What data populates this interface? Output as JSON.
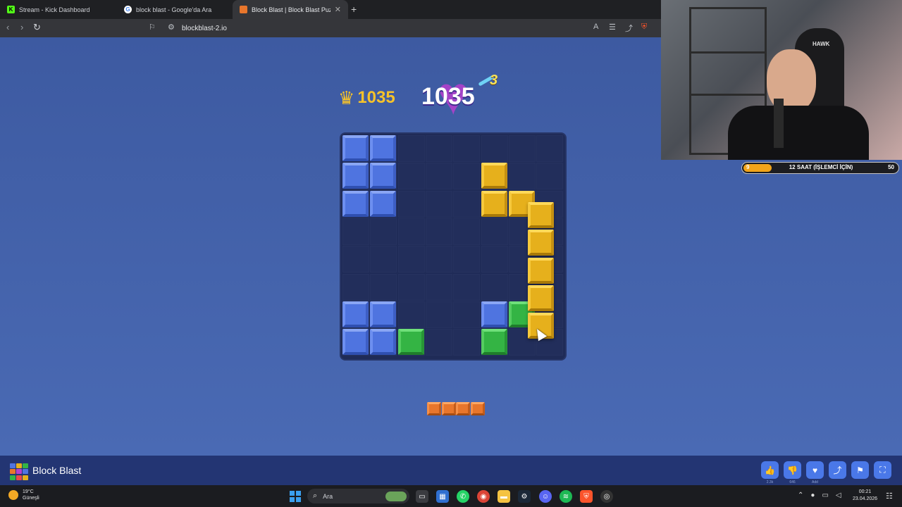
{
  "browser": {
    "tabs": [
      {
        "title": "Stream - Kick Dashboard",
        "icon": "kick-icon",
        "color": "#53fc18",
        "active": false
      },
      {
        "title": "block blast - Google'da Ara",
        "icon": "google-icon",
        "color": "#ffffff",
        "active": false
      },
      {
        "title": "Block Blast | Block Blast Puzzle G",
        "icon": "block-blast-icon",
        "color": "#e8762c",
        "active": true
      }
    ],
    "url": "blockblast-2.io"
  },
  "game": {
    "best_score": "1035",
    "current_score": "1035",
    "combo": "3",
    "board": {
      "rows": 8,
      "cols": 8,
      "blocks": [
        {
          "r": 0,
          "c": 0,
          "color": "blue"
        },
        {
          "r": 0,
          "c": 1,
          "color": "blue"
        },
        {
          "r": 1,
          "c": 0,
          "color": "blue"
        },
        {
          "r": 1,
          "c": 1,
          "color": "blue"
        },
        {
          "r": 2,
          "c": 0,
          "color": "blue"
        },
        {
          "r": 2,
          "c": 1,
          "color": "blue"
        },
        {
          "r": 1,
          "c": 5,
          "color": "yellow"
        },
        {
          "r": 2,
          "c": 5,
          "color": "yellow"
        },
        {
          "r": 2,
          "c": 6,
          "color": "yellow"
        },
        {
          "r": 6,
          "c": 0,
          "color": "blue"
        },
        {
          "r": 6,
          "c": 1,
          "color": "blue"
        },
        {
          "r": 7,
          "c": 0,
          "color": "blue"
        },
        {
          "r": 7,
          "c": 1,
          "color": "blue"
        },
        {
          "r": 7,
          "c": 2,
          "color": "green"
        },
        {
          "r": 6,
          "c": 5,
          "color": "blue"
        },
        {
          "r": 6,
          "c": 6,
          "color": "green"
        },
        {
          "r": 7,
          "c": 5,
          "color": "green"
        }
      ],
      "dragging_piece": {
        "color": "yellow",
        "cells": 5,
        "orientation": "vertical"
      }
    },
    "next_pieces": [
      {
        "color": "orange",
        "cells": 4,
        "orientation": "horizontal"
      }
    ],
    "title": "Block Blast",
    "actions": [
      {
        "name": "like-button",
        "icon": "thumbs-up-icon",
        "glyph": "👍",
        "count": "2.3k"
      },
      {
        "name": "dislike-button",
        "icon": "thumbs-down-icon",
        "glyph": "👎",
        "count": "646"
      },
      {
        "name": "favorite-button",
        "icon": "heart-icon",
        "glyph": "♥",
        "count": "Add"
      },
      {
        "name": "share-button",
        "icon": "share-icon",
        "glyph": "⤴",
        "count": ""
      },
      {
        "name": "report-button",
        "icon": "flag-icon",
        "glyph": "⚑",
        "count": ""
      },
      {
        "name": "fullscreen-button",
        "icon": "fullscreen-icon",
        "glyph": "⛶",
        "count": ""
      }
    ]
  },
  "stream_overlay": {
    "chair_brand": "HAWK",
    "goal": {
      "current": "9",
      "title": "12 SAAT (İŞLEMCİ İÇİN)",
      "target": "50",
      "progress": 0.18
    }
  },
  "taskbar": {
    "weather_temp": "19°C",
    "weather_desc": "Güneşli",
    "search_label": "Ara",
    "time": "00:21",
    "date": "23.04.2026"
  }
}
